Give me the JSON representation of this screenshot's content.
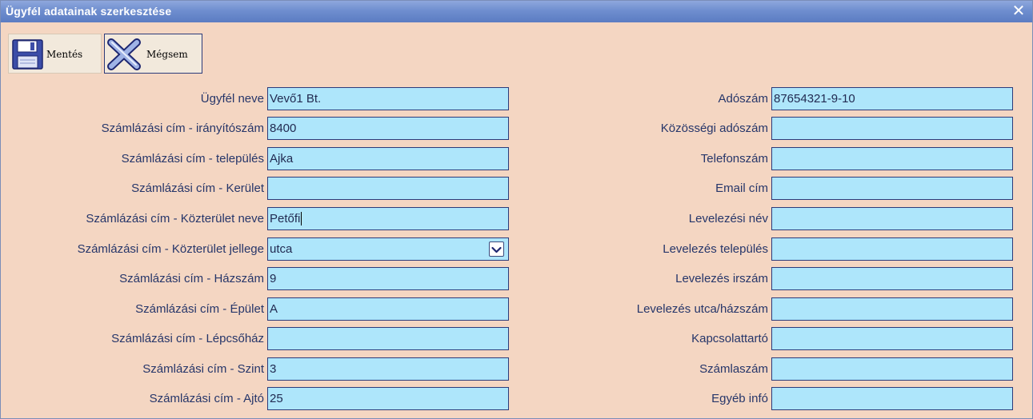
{
  "window": {
    "title": "Ügyfél adatainak szerkesztése",
    "close_glyph": "✕"
  },
  "toolbar": {
    "save_label": "Mentés",
    "save_icon": "floppy-disk-icon",
    "cancel_label": "Mégsem",
    "cancel_icon": "cross-icon"
  },
  "left_fields": [
    {
      "label": "Ügyfél neve",
      "value": "Vevő1 Bt."
    },
    {
      "label": "Számlázási cím - irányítószám",
      "value": "8400"
    },
    {
      "label": "Számlázási cím - település",
      "value": "Ajka"
    },
    {
      "label": "Számlázási cím - Kerület",
      "value": ""
    },
    {
      "label": "Számlázási cím - Közterület neve",
      "value": "Petőfi"
    },
    {
      "label": "Számlázási cím - Közterület jellege",
      "value": "utca"
    },
    {
      "label": "Számlázási cím - Házszám",
      "value": "9"
    },
    {
      "label": "Számlázási cím - Épület",
      "value": "A"
    },
    {
      "label": "Számlázási cím - Lépcsőház",
      "value": ""
    },
    {
      "label": "Számlázási cím - Szint",
      "value": "3"
    },
    {
      "label": "Számlázási cím - Ajtó",
      "value": "25"
    }
  ],
  "right_fields": [
    {
      "label": "Adószám",
      "value": "87654321-9-10"
    },
    {
      "label": "Közösségi adószám",
      "value": ""
    },
    {
      "label": "Telefonszám",
      "value": ""
    },
    {
      "label": "Email cím",
      "value": ""
    },
    {
      "label": "Levelezési név",
      "value": ""
    },
    {
      "label": "Levelezés település",
      "value": ""
    },
    {
      "label": "Levelezés irszám",
      "value": ""
    },
    {
      "label": "Levelezés utca/házszám",
      "value": ""
    },
    {
      "label": "Kapcsolattartó",
      "value": ""
    },
    {
      "label": "Számlaszám",
      "value": ""
    },
    {
      "label": "Egyéb infó",
      "value": ""
    }
  ],
  "colors": {
    "background": "#f4d6c2",
    "titlebar": "#6f8ecf",
    "input_fill": "#aee6fb",
    "input_border": "#2c3b7a",
    "label_text": "#26366a"
  }
}
